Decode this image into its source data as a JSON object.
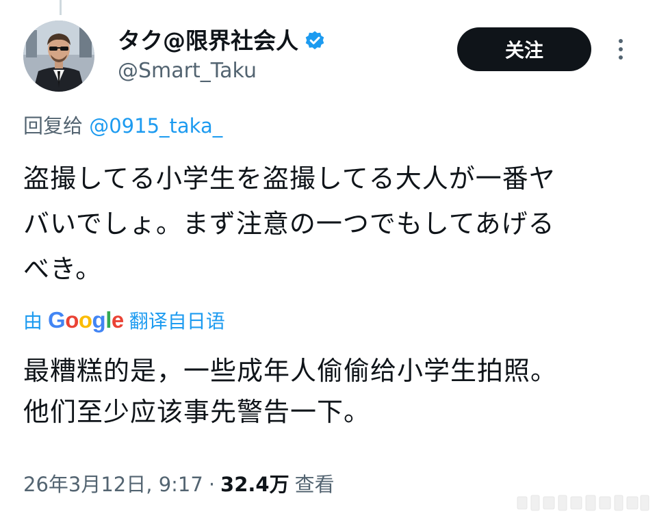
{
  "author": {
    "display_name": "タク@限界社会人",
    "handle": "@Smart_Taku",
    "verified_badge_icon": "verified-check-icon",
    "badge_color": "#1d9bf0"
  },
  "actions": {
    "follow_label": "关注",
    "more_icon": "more-vertical-icon"
  },
  "reply": {
    "prefix": "回复给",
    "mention": "@0915_taka_"
  },
  "tweet": {
    "text": "盗撮してる小学生を盗撮してる大人が一番ヤ\nバいでしょ。まず注意の一つでもしてあげる\nべき。"
  },
  "translation": {
    "by_label": "由",
    "google_letters": [
      "G",
      "o",
      "o",
      "g",
      "l",
      "e"
    ],
    "link_label": "翻译自日语",
    "text": "最糟糕的是，一些成年人偷偷给小学生拍照。\n他们至少应该事先警告一下。"
  },
  "meta": {
    "timestamp": "26年3月12日, 9:17",
    "separator": "·",
    "views_count": "32.4万",
    "views_label": "查看"
  },
  "colors": {
    "text_primary": "#0f1419",
    "text_secondary": "#536471",
    "link": "#1d9bf0",
    "follow_button_bg": "#0f1419"
  }
}
